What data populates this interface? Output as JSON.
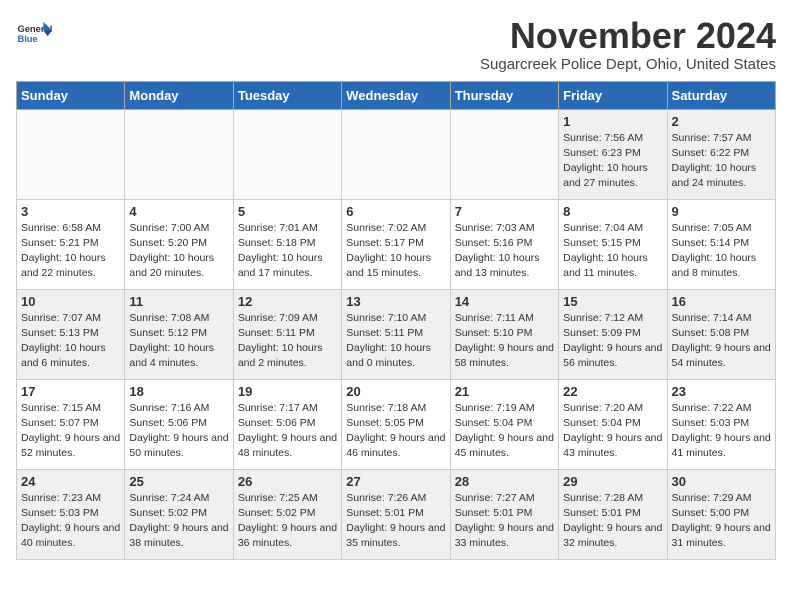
{
  "header": {
    "logo_general": "General",
    "logo_blue": "Blue",
    "month_title": "November 2024",
    "subtitle": "Sugarcreek Police Dept, Ohio, United States"
  },
  "weekdays": [
    "Sunday",
    "Monday",
    "Tuesday",
    "Wednesday",
    "Thursday",
    "Friday",
    "Saturday"
  ],
  "weeks": [
    [
      {
        "day": "",
        "info": "",
        "empty": true
      },
      {
        "day": "",
        "info": "",
        "empty": true
      },
      {
        "day": "",
        "info": "",
        "empty": true
      },
      {
        "day": "",
        "info": "",
        "empty": true
      },
      {
        "day": "",
        "info": "",
        "empty": true
      },
      {
        "day": "1",
        "info": "Sunrise: 7:56 AM\nSunset: 6:23 PM\nDaylight: 10 hours and 27 minutes.",
        "empty": false
      },
      {
        "day": "2",
        "info": "Sunrise: 7:57 AM\nSunset: 6:22 PM\nDaylight: 10 hours and 24 minutes.",
        "empty": false
      }
    ],
    [
      {
        "day": "3",
        "info": "Sunrise: 6:58 AM\nSunset: 5:21 PM\nDaylight: 10 hours and 22 minutes.",
        "empty": false
      },
      {
        "day": "4",
        "info": "Sunrise: 7:00 AM\nSunset: 5:20 PM\nDaylight: 10 hours and 20 minutes.",
        "empty": false
      },
      {
        "day": "5",
        "info": "Sunrise: 7:01 AM\nSunset: 5:18 PM\nDaylight: 10 hours and 17 minutes.",
        "empty": false
      },
      {
        "day": "6",
        "info": "Sunrise: 7:02 AM\nSunset: 5:17 PM\nDaylight: 10 hours and 15 minutes.",
        "empty": false
      },
      {
        "day": "7",
        "info": "Sunrise: 7:03 AM\nSunset: 5:16 PM\nDaylight: 10 hours and 13 minutes.",
        "empty": false
      },
      {
        "day": "8",
        "info": "Sunrise: 7:04 AM\nSunset: 5:15 PM\nDaylight: 10 hours and 11 minutes.",
        "empty": false
      },
      {
        "day": "9",
        "info": "Sunrise: 7:05 AM\nSunset: 5:14 PM\nDaylight: 10 hours and 8 minutes.",
        "empty": false
      }
    ],
    [
      {
        "day": "10",
        "info": "Sunrise: 7:07 AM\nSunset: 5:13 PM\nDaylight: 10 hours and 6 minutes.",
        "empty": false
      },
      {
        "day": "11",
        "info": "Sunrise: 7:08 AM\nSunset: 5:12 PM\nDaylight: 10 hours and 4 minutes.",
        "empty": false
      },
      {
        "day": "12",
        "info": "Sunrise: 7:09 AM\nSunset: 5:11 PM\nDaylight: 10 hours and 2 minutes.",
        "empty": false
      },
      {
        "day": "13",
        "info": "Sunrise: 7:10 AM\nSunset: 5:11 PM\nDaylight: 10 hours and 0 minutes.",
        "empty": false
      },
      {
        "day": "14",
        "info": "Sunrise: 7:11 AM\nSunset: 5:10 PM\nDaylight: 9 hours and 58 minutes.",
        "empty": false
      },
      {
        "day": "15",
        "info": "Sunrise: 7:12 AM\nSunset: 5:09 PM\nDaylight: 9 hours and 56 minutes.",
        "empty": false
      },
      {
        "day": "16",
        "info": "Sunrise: 7:14 AM\nSunset: 5:08 PM\nDaylight: 9 hours and 54 minutes.",
        "empty": false
      }
    ],
    [
      {
        "day": "17",
        "info": "Sunrise: 7:15 AM\nSunset: 5:07 PM\nDaylight: 9 hours and 52 minutes.",
        "empty": false
      },
      {
        "day": "18",
        "info": "Sunrise: 7:16 AM\nSunset: 5:06 PM\nDaylight: 9 hours and 50 minutes.",
        "empty": false
      },
      {
        "day": "19",
        "info": "Sunrise: 7:17 AM\nSunset: 5:06 PM\nDaylight: 9 hours and 48 minutes.",
        "empty": false
      },
      {
        "day": "20",
        "info": "Sunrise: 7:18 AM\nSunset: 5:05 PM\nDaylight: 9 hours and 46 minutes.",
        "empty": false
      },
      {
        "day": "21",
        "info": "Sunrise: 7:19 AM\nSunset: 5:04 PM\nDaylight: 9 hours and 45 minutes.",
        "empty": false
      },
      {
        "day": "22",
        "info": "Sunrise: 7:20 AM\nSunset: 5:04 PM\nDaylight: 9 hours and 43 minutes.",
        "empty": false
      },
      {
        "day": "23",
        "info": "Sunrise: 7:22 AM\nSunset: 5:03 PM\nDaylight: 9 hours and 41 minutes.",
        "empty": false
      }
    ],
    [
      {
        "day": "24",
        "info": "Sunrise: 7:23 AM\nSunset: 5:03 PM\nDaylight: 9 hours and 40 minutes.",
        "empty": false
      },
      {
        "day": "25",
        "info": "Sunrise: 7:24 AM\nSunset: 5:02 PM\nDaylight: 9 hours and 38 minutes.",
        "empty": false
      },
      {
        "day": "26",
        "info": "Sunrise: 7:25 AM\nSunset: 5:02 PM\nDaylight: 9 hours and 36 minutes.",
        "empty": false
      },
      {
        "day": "27",
        "info": "Sunrise: 7:26 AM\nSunset: 5:01 PM\nDaylight: 9 hours and 35 minutes.",
        "empty": false
      },
      {
        "day": "28",
        "info": "Sunrise: 7:27 AM\nSunset: 5:01 PM\nDaylight: 9 hours and 33 minutes.",
        "empty": false
      },
      {
        "day": "29",
        "info": "Sunrise: 7:28 AM\nSunset: 5:01 PM\nDaylight: 9 hours and 32 minutes.",
        "empty": false
      },
      {
        "day": "30",
        "info": "Sunrise: 7:29 AM\nSunset: 5:00 PM\nDaylight: 9 hours and 31 minutes.",
        "empty": false
      }
    ]
  ]
}
